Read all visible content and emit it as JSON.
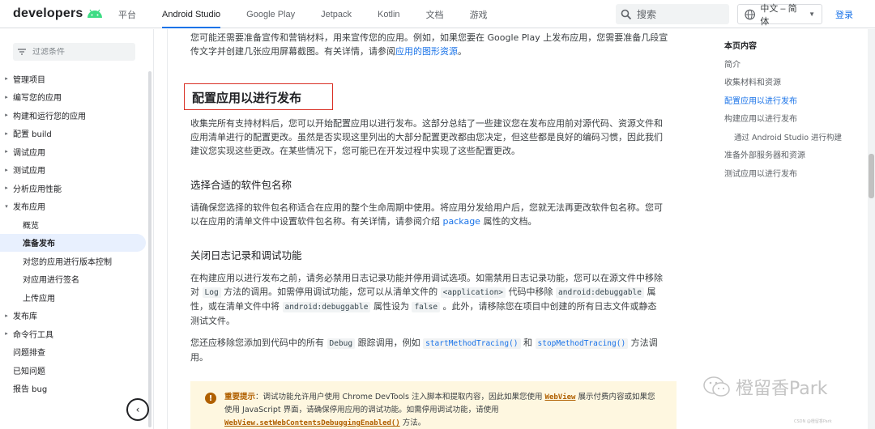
{
  "header": {
    "logo": "developers",
    "nav": [
      "平台",
      "Android Studio",
      "Google Play",
      "Jetpack",
      "Kotlin",
      "文档",
      "游戏"
    ],
    "active_nav": "Android Studio",
    "search_placeholder": "搜索",
    "language": "中文 – 简体",
    "login": "登录"
  },
  "sidebar": {
    "filter_placeholder": "过滤条件",
    "items": [
      {
        "label": "管理项目",
        "arrow": "▸"
      },
      {
        "label": "编写您的应用",
        "arrow": "▸"
      },
      {
        "label": "构建和运行您的应用",
        "arrow": "▸"
      },
      {
        "label": "配置 build",
        "arrow": "▸"
      },
      {
        "label": "调试应用",
        "arrow": "▸"
      },
      {
        "label": "测试应用",
        "arrow": "▸"
      },
      {
        "label": "分析应用性能",
        "arrow": "▸"
      },
      {
        "label": "发布应用",
        "arrow": "▾"
      },
      {
        "label": "概览"
      },
      {
        "label": "准备发布"
      },
      {
        "label": "对您的应用进行版本控制"
      },
      {
        "label": "对应用进行签名"
      },
      {
        "label": "上传应用"
      },
      {
        "label": "发布库",
        "arrow": "▸"
      },
      {
        "label": "命令行工具",
        "arrow": "▸"
      },
      {
        "label": "问题排查"
      },
      {
        "label": "已知问题"
      },
      {
        "label": "报告 bug"
      }
    ]
  },
  "main": {
    "intro_1": "您可能还需要准备宣传和营销材料，用来宣传您的应用。例如，如果您要在 Google Play 上发布应用，您需要准备几段宣",
    "intro_2a": "传文字并创建几张应用屏幕截图。有关详情，请参阅",
    "intro_2_link": "应用的图形资源",
    "intro_2b": "。",
    "h2": "配置应用以进行发布",
    "p1_1": "收集完所有支持材料后，您可以开始配置应用以进行发布。这部分总结了一些建议您在发布应用前对源代码、资源文件和",
    "p1_2": "应用清单进行的配置更改。虽然是否实现这里列出的大部分配置更改都由您决定，但这些都是良好的编码习惯，因此我们",
    "p1_3": "建议您实现这些更改。在某些情况下，您可能已在开发过程中实现了这些配置更改。",
    "h3_1": "选择合适的软件包名称",
    "p2_1": "请确保您选择的软件包名称适合在应用的整个生命周期中使用。将应用分发给用户后，您就无法再更改软件包名称。您可",
    "p2_2a": "以在应用的清单文件中设置软件包名称。有关详情，请参阅介绍 ",
    "p2_2_link": "package",
    "p2_2b": " 属性的文档。",
    "h3_2": "关闭日志记录和调试功能",
    "p3_1": "在构建应用以进行发布之前，请务必禁用日志记录功能并停用调试选项。如需禁用日志记录功能，您可以在源文件中移除",
    "p3_2a": "对 ",
    "p3_2_code1": "Log",
    "p3_2b": " 方法的调用。如需停用调试功能，您可以从清单文件的 ",
    "p3_2_code2": "<application>",
    "p3_2c": " 代码中移除 ",
    "p3_2_code3": "android:debuggable",
    "p3_2d": " 属",
    "p3_3a": "性，或在清单文件中将 ",
    "p3_3_code1": "android:debuggable",
    "p3_3b": " 属性设为 ",
    "p3_3_code2": "false",
    "p3_3c": " 。此外，请移除您在项目中创建的所有日志文件或静态",
    "p3_4": "测试文件。",
    "p4_1a": "您还应移除您添加到代码中的所有 ",
    "p4_1_code1": "Debug",
    "p4_1b": " 跟踪调用，例如 ",
    "p4_1_code2": "startMethodTracing()",
    "p4_1c": " 和 ",
    "p4_1_code3": "stopMethodTracing()",
    "p4_1d": " 方法调",
    "p4_2": "用。",
    "callout_label": "重要提示",
    "callout_1": "：调试功能允许用户使用 Chrome DevTools 注入脚本和提取内容，因此如果您使用 ",
    "callout_1_link": "WebView",
    "callout_1b": " 展示付费内容或如果您",
    "callout_2": "使用 JavaScript 界面，请确保停用应用的调试功能。如需停用调试功能，请使用",
    "callout_3_link": "WebView.setWebContentsDebuggingEnabled()",
    "callout_3b": " 方法。"
  },
  "toc": {
    "title": "本页内容",
    "items": [
      "简介",
      "收集材料和资源",
      "配置应用以进行发布",
      "构建应用以进行发布",
      "通过 Android Studio 进行构建",
      "准备外部服务器和资源",
      "测试应用以进行发布"
    ],
    "active": "配置应用以进行发布"
  },
  "watermark": {
    "text": "橙留香Park",
    "small": "CSDN @橙留香Park"
  },
  "colors": {
    "accent": "#1a73e8",
    "android_green": "#3ddc84",
    "highlight_box": "#d93025",
    "callout_bg": "#fef7e0"
  }
}
